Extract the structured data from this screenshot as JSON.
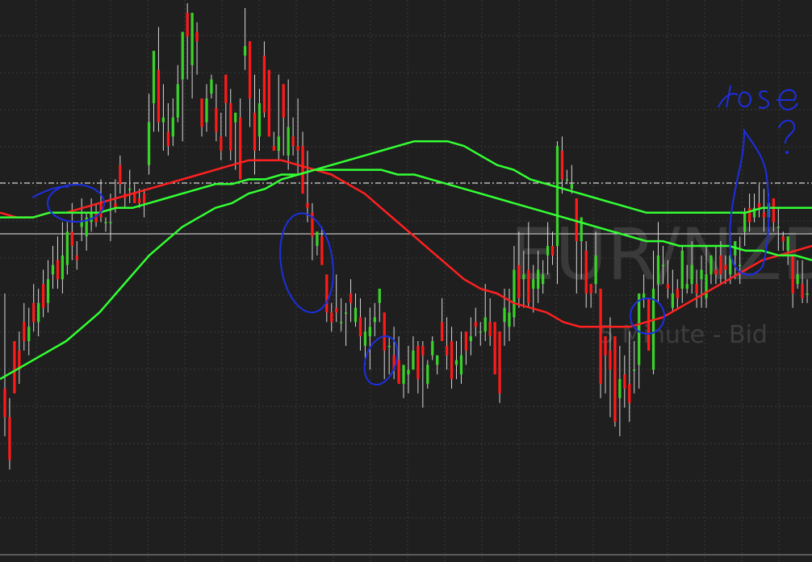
{
  "chart_data": {
    "type": "candlestick",
    "symbol_watermark": "EUR/NZD",
    "timeframe_watermark": "5 Minute - Bid",
    "background": "#1f1f1f",
    "grid": true,
    "y_range": [
      0,
      100
    ],
    "colors": {
      "up": "#3ad12b",
      "down": "#ff1a1a",
      "wick": "#d8d8d8",
      "faded_up": "#1f5a1f",
      "faded_down": "#6a2a2a"
    },
    "candles": [
      [
        20,
        14,
        40,
        10
      ],
      [
        14,
        5,
        18,
        3
      ],
      [
        30,
        19,
        30,
        22
      ],
      [
        28,
        24,
        32,
        21
      ],
      [
        34,
        30,
        38,
        28
      ],
      [
        30,
        33,
        37,
        27
      ],
      [
        38,
        34,
        42,
        32
      ],
      [
        34,
        38,
        41,
        31
      ],
      [
        42,
        37,
        45,
        35
      ],
      [
        38,
        43,
        47,
        36
      ],
      [
        44,
        46,
        50,
        41
      ],
      [
        47,
        43,
        52,
        41
      ],
      [
        43,
        48,
        55,
        40
      ],
      [
        46,
        53,
        55,
        44
      ],
      [
        53,
        50,
        59,
        47
      ],
      [
        48,
        47,
        51,
        45
      ],
      [
        54,
        55,
        60,
        51
      ],
      [
        52,
        56,
        57,
        49
      ],
      [
        55,
        57,
        60,
        53
      ],
      [
        57,
        55,
        59,
        54
      ],
      [
        59,
        56,
        64,
        55
      ],
      [
        55,
        55,
        56,
        53
      ],
      [
        55,
        55,
        61,
        51
      ],
      [
        59,
        58,
        64,
        57
      ],
      [
        67,
        63,
        69,
        61
      ],
      [
        61,
        60,
        63,
        58
      ],
      [
        62,
        62,
        66,
        59
      ],
      [
        61,
        59,
        63,
        59
      ],
      [
        60,
        59,
        62,
        58
      ],
      [
        61,
        59,
        62,
        56
      ],
      [
        67,
        76,
        82,
        65
      ],
      [
        80,
        91,
        90,
        74
      ],
      [
        87,
        76,
        96,
        74
      ],
      [
        76,
        77,
        84,
        70
      ],
      [
        74,
        71,
        80,
        69
      ],
      [
        73,
        77,
        81,
        71
      ],
      [
        77,
        84,
        88,
        76
      ],
      [
        85,
        95,
        95,
        72
      ],
      [
        99,
        94,
        101,
        85
      ],
      [
        88,
        99,
        96,
        81
      ],
      [
        95,
        93,
        97,
        86
      ],
      [
        81,
        75,
        79,
        73
      ],
      [
        76,
        81,
        84,
        74
      ],
      [
        82,
        85,
        86,
        81
      ],
      [
        79,
        74,
        84,
        72
      ],
      [
        73,
        70,
        78,
        68
      ],
      [
        86,
        80,
        83,
        73
      ],
      [
        80,
        70,
        83,
        68
      ],
      [
        76,
        78,
        78,
        66
      ],
      [
        77,
        64,
        81,
        64
      ],
      [
        90,
        92,
        100,
        87
      ],
      [
        93,
        81,
        88,
        75
      ],
      [
        78,
        70,
        86,
        65
      ],
      [
        73,
        80,
        83,
        70
      ],
      [
        90,
        78,
        93,
        77
      ],
      [
        87,
        73,
        86,
        73
      ],
      [
        71,
        70,
        74,
        70
      ],
      [
        70,
        73,
        86,
        68
      ],
      [
        84,
        77,
        84,
        69
      ],
      [
        69,
        75,
        85,
        66
      ],
      [
        73,
        71,
        77,
        69
      ],
      [
        71,
        70,
        81,
        65
      ],
      [
        71,
        61,
        74,
        61
      ],
      [
        59,
        58,
        70,
        55
      ],
      [
        57,
        52,
        59,
        47
      ],
      [
        50,
        53,
        53,
        48
      ],
      [
        52,
        46,
        54,
        46
      ],
      [
        44,
        36,
        41,
        34
      ],
      [
        36,
        34,
        38,
        32
      ],
      [
        37,
        36,
        44,
        34
      ],
      [
        34,
        34,
        39,
        32
      ],
      [
        36,
        36,
        38,
        29
      ],
      [
        40,
        38,
        43,
        34
      ],
      [
        34,
        37,
        40,
        33
      ],
      [
        35,
        31,
        39,
        28
      ],
      [
        29,
        32,
        35,
        25
      ],
      [
        31,
        33,
        37,
        24
      ],
      [
        34,
        35,
        38,
        31
      ],
      [
        38,
        41,
        40,
        34
      ],
      [
        36,
        28,
        36,
        22
      ],
      [
        29,
        29,
        31,
        23
      ],
      [
        27,
        24,
        33,
        22
      ],
      [
        26,
        21,
        31,
        22
      ],
      [
        21,
        25,
        23,
        18
      ],
      [
        23,
        24,
        29,
        19
      ],
      [
        24,
        28,
        31,
        24
      ],
      [
        29,
        22,
        30,
        19
      ],
      [
        29,
        27,
        30,
        16
      ],
      [
        21,
        25,
        26,
        20
      ],
      [
        27,
        30,
        31,
        26
      ],
      [
        25,
        27,
        27,
        23
      ],
      [
        34,
        30,
        39,
        30
      ],
      [
        29,
        27,
        35,
        24
      ],
      [
        30,
        22,
        33,
        20
      ],
      [
        25,
        26,
        30,
        22
      ],
      [
        23,
        27,
        32,
        21
      ],
      [
        32,
        28,
        30,
        25
      ],
      [
        30,
        31,
        35,
        27
      ],
      [
        34,
        33,
        37,
        31
      ],
      [
        32,
        32,
        34,
        29
      ],
      [
        32,
        35,
        42,
        30
      ],
      [
        34,
        31,
        39,
        29
      ],
      [
        34,
        23,
        34,
        25
      ],
      [
        32,
        19,
        30,
        17
      ],
      [
        34,
        37,
        41,
        29
      ],
      [
        33,
        36,
        41,
        30
      ],
      [
        35,
        45,
        50,
        33
      ],
      [
        46,
        39,
        53,
        37
      ],
      [
        43,
        44,
        49,
        37
      ],
      [
        45,
        38,
        55,
        37
      ],
      [
        41,
        43,
        46,
        36
      ],
      [
        41,
        45,
        49,
        38
      ],
      [
        42,
        44,
        47,
        40
      ],
      [
        48,
        50,
        55,
        44
      ],
      [
        50,
        48,
        53,
        46
      ],
      [
        50,
        71,
        72,
        42
      ],
      [
        70,
        64,
        73,
        61
      ],
      [
        64,
        64,
        66,
        63
      ],
      [
        62,
        63,
        67,
        61
      ],
      [
        60,
        51,
        60,
        40
      ],
      [
        51,
        56,
        56,
        43
      ],
      [
        49,
        40,
        51,
        37
      ],
      [
        42,
        40,
        40,
        37
      ],
      [
        42,
        48,
        53,
        40
      ],
      [
        41,
        21,
        34,
        18
      ],
      [
        31,
        27,
        31,
        19
      ],
      [
        28,
        24,
        35,
        14
      ],
      [
        31,
        13,
        28,
        12
      ],
      [
        18,
        22,
        29,
        10
      ],
      [
        23,
        20,
        27,
        16
      ],
      [
        21,
        17,
        32,
        13
      ],
      [
        24,
        24,
        30,
        19
      ],
      [
        25,
        40,
        38,
        20
      ],
      [
        39,
        40,
        44,
        37
      ],
      [
        39,
        28,
        39,
        28
      ],
      [
        24,
        41,
        49,
        23
      ],
      [
        42,
        48,
        55,
        38
      ],
      [
        46,
        46,
        50,
        42
      ],
      [
        42,
        41,
        47,
        39
      ],
      [
        37,
        40,
        45,
        36
      ],
      [
        41,
        39,
        43,
        37
      ],
      [
        41,
        49,
        50,
        38
      ],
      [
        41,
        42,
        46,
        40
      ],
      [
        42,
        46,
        51,
        40
      ],
      [
        42,
        40,
        45,
        37
      ],
      [
        43,
        45,
        48,
        37
      ],
      [
        39,
        44,
        50,
        37
      ],
      [
        44,
        48,
        48,
        42
      ],
      [
        45,
        44,
        50,
        42
      ],
      [
        48,
        44,
        51,
        42
      ],
      [
        46,
        45,
        48,
        42
      ],
      [
        44,
        48,
        53,
        42
      ],
      [
        48,
        51,
        51,
        43
      ],
      [
        46,
        46,
        52,
        42
      ],
      [
        53,
        57,
        58,
        50
      ],
      [
        58,
        55,
        61,
        53
      ],
      [
        56,
        58,
        61,
        55
      ],
      [
        59,
        58,
        63,
        56
      ],
      [
        57,
        56,
        62,
        53
      ],
      [
        56,
        59,
        61,
        53
      ],
      [
        60,
        55,
        60,
        53
      ],
      [
        54,
        54,
        58,
        49
      ],
      [
        52,
        51,
        53,
        49
      ],
      [
        49,
        52,
        52,
        46
      ],
      [
        48,
        40,
        48,
        37
      ],
      [
        42,
        44,
        47,
        41
      ],
      [
        42,
        39,
        47,
        38
      ],
      [
        40,
        40,
        43,
        38
      ]
    ],
    "ma_green_fast": [
      22,
      24,
      26,
      28,
      30,
      33,
      36,
      40,
      44,
      48,
      51,
      54,
      56,
      58,
      59,
      61,
      62,
      64,
      65,
      66,
      67,
      68,
      69,
      70,
      71,
      72,
      72,
      72,
      71,
      69,
      67,
      66,
      64,
      63,
      62,
      61,
      60,
      59,
      58,
      57,
      57,
      57,
      57,
      57,
      57,
      57,
      58,
      58,
      58,
      58
    ],
    "ma_green_slow": [
      56,
      56,
      56,
      57,
      57,
      57,
      57,
      58,
      58,
      59,
      60,
      61,
      62,
      63,
      63,
      64,
      64,
      65,
      65,
      66,
      66,
      66,
      66,
      66,
      65,
      65,
      64,
      63,
      62,
      61,
      60,
      59,
      58,
      57,
      56,
      55,
      54,
      53,
      52,
      51,
      51,
      50,
      50,
      50,
      50,
      49,
      49,
      48,
      48,
      47
    ],
    "ma_red": [
      57,
      56,
      56,
      57,
      57,
      58,
      59,
      60,
      61,
      62,
      63,
      64,
      65,
      66,
      67,
      68,
      68,
      68,
      67,
      66,
      65,
      63,
      61,
      58,
      55,
      52,
      49,
      46,
      43,
      41,
      40,
      38,
      37,
      36,
      34,
      33,
      33,
      33,
      33,
      34,
      35,
      37,
      39,
      41,
      43,
      45,
      47,
      48,
      49,
      50
    ]
  }
}
